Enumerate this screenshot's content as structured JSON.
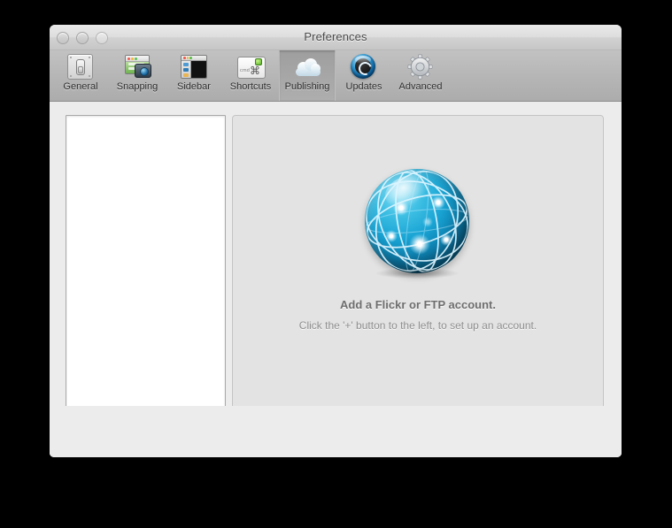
{
  "window": {
    "title": "Preferences",
    "traffic_lights": [
      "close-button",
      "minimize-button",
      "zoom-button"
    ]
  },
  "toolbar": {
    "items": [
      {
        "label": "General",
        "icon": "switch-plate-icon",
        "selected": false
      },
      {
        "label": "Snapping",
        "icon": "window-camera-icon",
        "selected": false
      },
      {
        "label": "Sidebar",
        "icon": "window-sidebar-icon",
        "selected": false
      },
      {
        "label": "Shortcuts",
        "icon": "keyboard-key-icon",
        "selected": false
      },
      {
        "label": "Publishing",
        "icon": "cloud-icon",
        "selected": true
      },
      {
        "label": "Updates",
        "icon": "refresh-sphere-icon",
        "selected": false
      },
      {
        "label": "Advanced",
        "icon": "gear-icon",
        "selected": false
      }
    ]
  },
  "accounts_list": {
    "items": [],
    "empty": true
  },
  "content": {
    "icon": "network-globe-icon",
    "headline": "Add a Flickr or FTP account.",
    "subline": "Click the '+' button to the left, to set up an account."
  },
  "buttons": {
    "add_label": "+",
    "remove_label": "−"
  },
  "colors": {
    "window_body": "#ececec",
    "content_pane": "#e3e3e3",
    "toolbar": "#b6b6b6",
    "globe_blue": "#19a4d4",
    "headline_text": "#6e6e6e",
    "subline_text": "#8e8e8e",
    "backdrop": "#000000"
  }
}
